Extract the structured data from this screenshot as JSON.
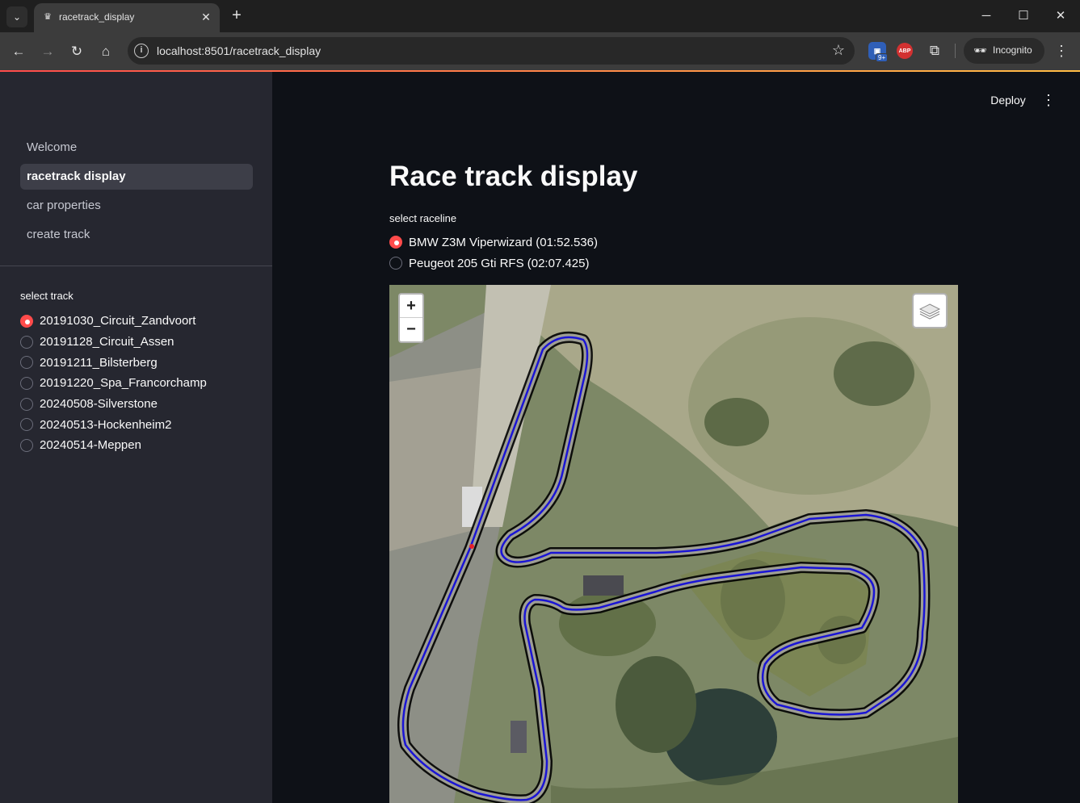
{
  "browser": {
    "tab_title": "racetrack_display",
    "url": "localhost:8501/racetrack_display",
    "profile_label": "Incognito",
    "ext_badge": "9+",
    "abp_label": "ABP"
  },
  "app": {
    "header": {
      "deploy_label": "Deploy"
    },
    "sidebar": {
      "nav": [
        {
          "label": "Welcome",
          "active": false
        },
        {
          "label": "racetrack display",
          "active": true
        },
        {
          "label": "car properties",
          "active": false
        },
        {
          "label": "create track",
          "active": false
        }
      ],
      "track_label": "select track",
      "tracks": [
        {
          "label": "20191030_Circuit_Zandvoort",
          "selected": true
        },
        {
          "label": "20191128_Circuit_Assen",
          "selected": false
        },
        {
          "label": "20191211_Bilsterberg",
          "selected": false
        },
        {
          "label": "20191220_Spa_Francorchamp",
          "selected": false
        },
        {
          "label": "20240508-Silverstone",
          "selected": false
        },
        {
          "label": "20240513-Hockenheim2",
          "selected": false
        },
        {
          "label": "20240514-Meppen",
          "selected": false
        }
      ]
    },
    "main": {
      "title": "Race track display",
      "raceline_label": "select raceline",
      "racelines": [
        {
          "label": "BMW Z3M Viperwizard (01:52.536)",
          "selected": true
        },
        {
          "label": "Peugeot 205 Gti RFS (02:07.425)",
          "selected": false
        }
      ],
      "map": {
        "zoom_in": "+",
        "zoom_out": "−",
        "track_outline_color": "#000000",
        "raceline_color": "#1a14d6",
        "marker_color": "#e8202a"
      }
    }
  }
}
